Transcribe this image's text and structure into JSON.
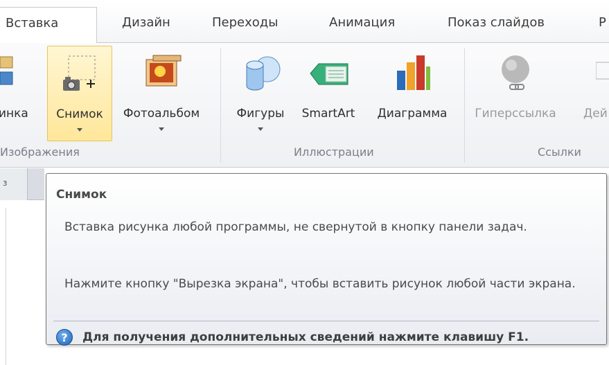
{
  "tabs": [
    {
      "label": "Вставка",
      "active": true
    },
    {
      "label": "Дизайн"
    },
    {
      "label": "Переходы"
    },
    {
      "label": "Анимация"
    },
    {
      "label": "Показ слайдов"
    },
    {
      "label": "Р"
    }
  ],
  "groups": {
    "images": {
      "label": "Изображения",
      "buttons": [
        {
          "label": "инка"
        },
        {
          "label": "Снимок",
          "icon": "screenshot-icon"
        },
        {
          "label": "Фотоальбом",
          "icon": "photo-album-icon"
        }
      ]
    },
    "illustrations": {
      "label": "Иллюстрации",
      "buttons": [
        {
          "label": "Фигуры",
          "icon": "shapes-icon"
        },
        {
          "label": "SmartArt",
          "icon": "smartart-icon"
        },
        {
          "label": "Диаграмма",
          "icon": "chart-icon"
        }
      ]
    },
    "links": {
      "label": "Ссылки",
      "buttons": [
        {
          "label": "Гиперссылка",
          "icon": "hyperlink-icon"
        },
        {
          "label": "Дей"
        }
      ]
    }
  },
  "row_header": "з",
  "tooltip": {
    "title": "Снимок",
    "para1": "Вставка рисунка любой программы, не свернутой в кнопку панели задач.",
    "para2": "Нажмите кнопку \"Вырезка экрана\", чтобы вставить рисунок любой части экрана.",
    "help": "Для получения дополнительных сведений нажмите клавишу F1.",
    "help_icon": "?"
  }
}
